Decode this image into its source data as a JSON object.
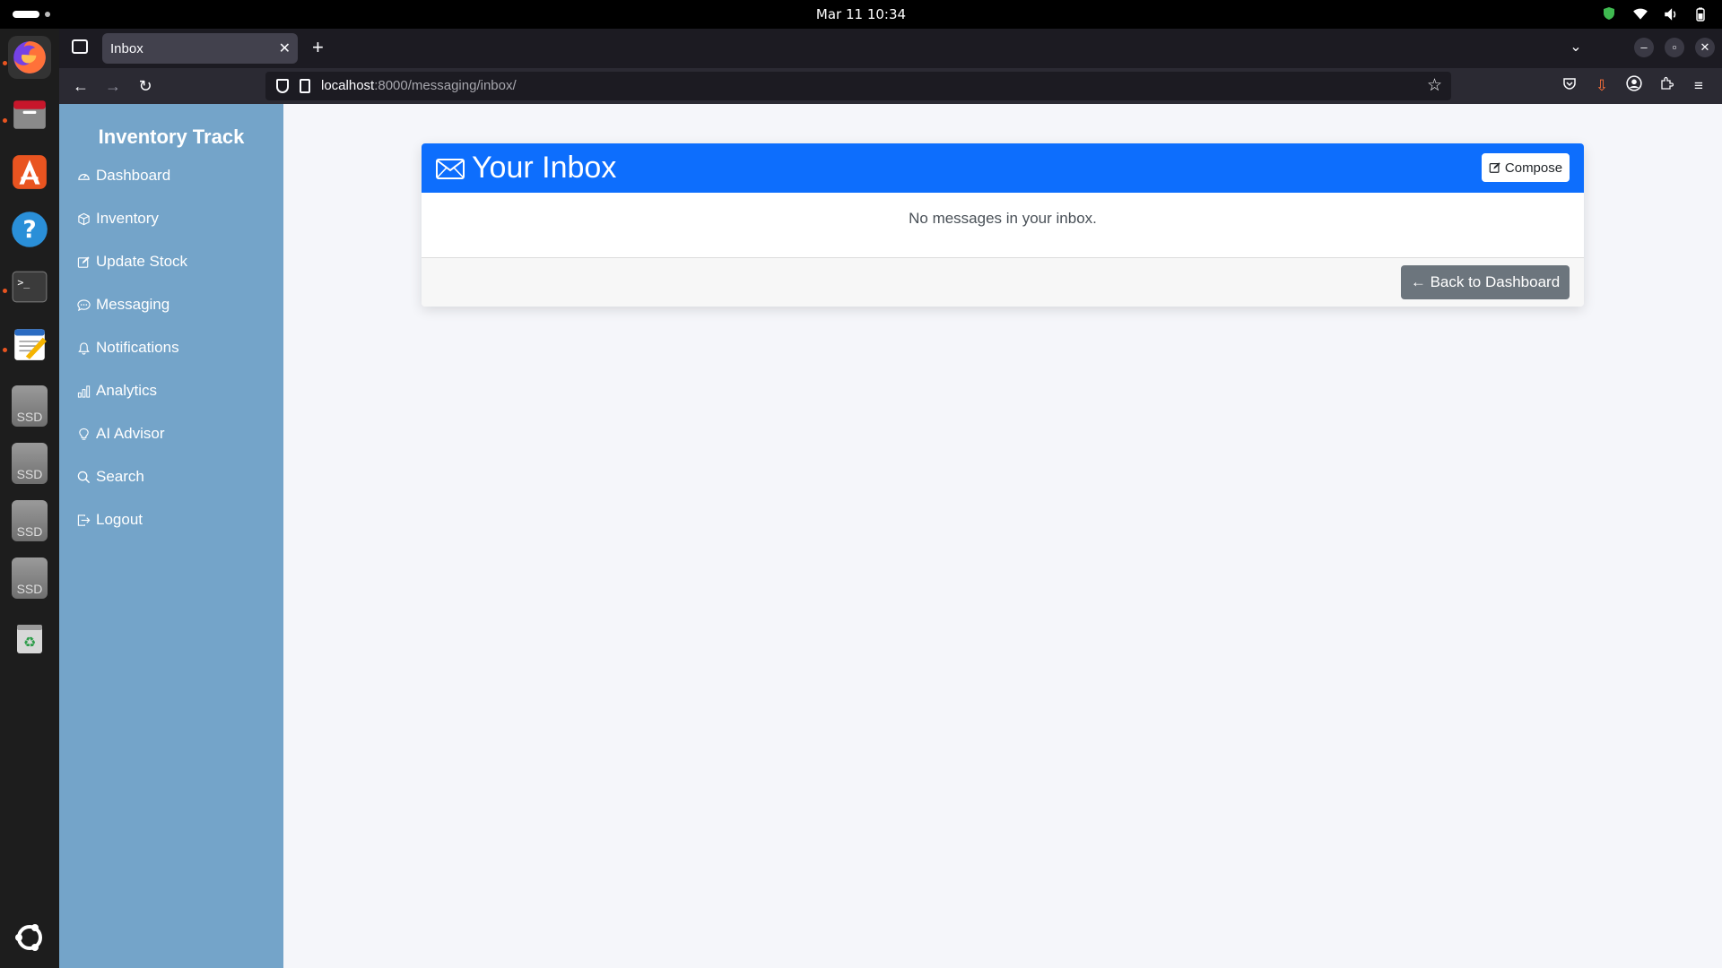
{
  "topbar": {
    "clock": "Mar 11  10:34"
  },
  "dock": {
    "items": [
      "firefox-icon",
      "files-icon",
      "app-center-icon",
      "help-icon",
      "terminal-icon",
      "text-editor-icon",
      "ssd-drive-icon",
      "ssd-drive-icon",
      "ssd-drive-icon",
      "ssd-drive-icon",
      "trash-icon",
      "ubuntu-logo-icon"
    ],
    "ssd_label": "SSD"
  },
  "browser": {
    "tab_title": "Inbox",
    "url_host": "localhost",
    "url_path": ":8000/messaging/inbox/"
  },
  "sidebar": {
    "brand": "Inventory Track",
    "items": [
      {
        "label": "Dashboard",
        "icon": "speedometer-icon"
      },
      {
        "label": "Inventory",
        "icon": "box-icon"
      },
      {
        "label": "Update Stock",
        "icon": "pencil-square-icon"
      },
      {
        "label": "Messaging",
        "icon": "chat-dots-icon"
      },
      {
        "label": "Notifications",
        "icon": "bell-icon"
      },
      {
        "label": "Analytics",
        "icon": "bar-chart-icon"
      },
      {
        "label": "AI Advisor",
        "icon": "lightbulb-icon"
      },
      {
        "label": "Search",
        "icon": "search-icon"
      },
      {
        "label": "Logout",
        "icon": "box-arrow-right-icon"
      }
    ]
  },
  "inbox": {
    "title": "Your Inbox",
    "compose_label": "Compose",
    "empty_message": "No messages in your inbox.",
    "back_label": "← Back to Dashboard"
  },
  "colors": {
    "header_blue": "#0d6efd",
    "sidebar_blue": "#74a4c9",
    "back_button_gray": "#6c757d"
  }
}
